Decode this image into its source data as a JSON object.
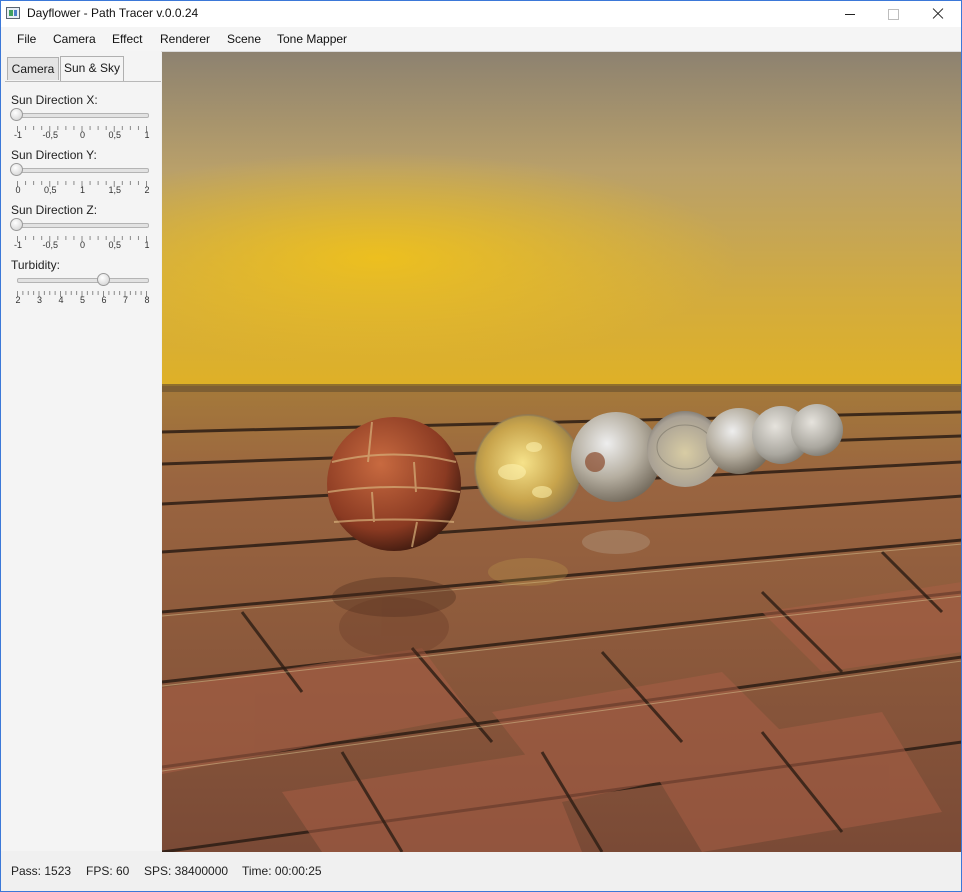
{
  "window": {
    "title": "Dayflower - Path Tracer v.0.0.24"
  },
  "menubar": {
    "items": [
      "File",
      "Camera",
      "Effect",
      "Renderer",
      "Scene",
      "Tone Mapper"
    ]
  },
  "sidepanel": {
    "tabs": [
      "Camera",
      "Sun & Sky"
    ],
    "active_tab": "Sun & Sky",
    "sliders": [
      {
        "label": "Sun Direction X:",
        "ticks": [
          "-1",
          "-0,5",
          "0",
          "0,5",
          "1"
        ],
        "value": -1,
        "min": -1,
        "max": 1
      },
      {
        "label": "Sun Direction Y:",
        "ticks": [
          "0",
          "0,5",
          "1",
          "1,5",
          "2"
        ],
        "value": 0,
        "min": 0,
        "max": 2
      },
      {
        "label": "Sun Direction Z:",
        "ticks": [
          "-1",
          "-0,5",
          "0",
          "0,5",
          "1"
        ],
        "value": -1,
        "min": -1,
        "max": 1
      },
      {
        "label": "Turbidity:",
        "ticks": [
          "2",
          "3",
          "4",
          "5",
          "6",
          "7",
          "8"
        ],
        "value": 6,
        "min": 2,
        "max": 8
      }
    ]
  },
  "render": {
    "scene_description_icon": "rendered-scene"
  },
  "statusbar": {
    "pass": "Pass: 1523",
    "fps": "FPS: 60",
    "sps": "SPS: 38400000",
    "time": "Time: 00:00:25"
  }
}
